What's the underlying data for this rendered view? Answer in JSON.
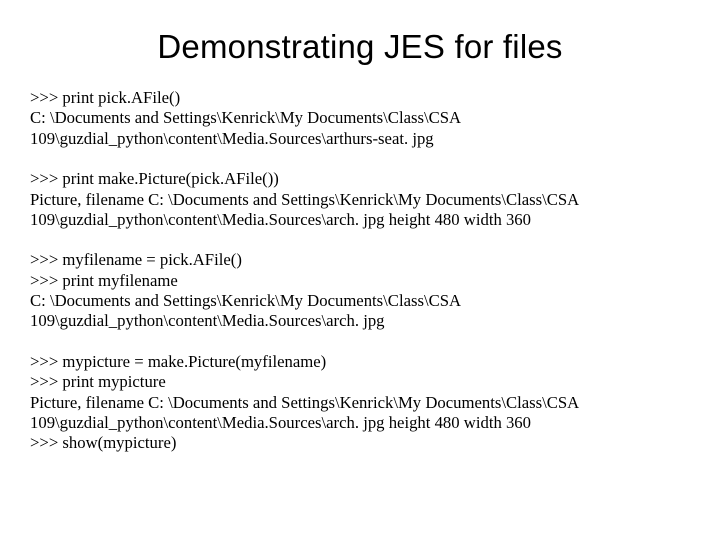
{
  "title": "Demonstrating JES for files",
  "blocks": [
    {
      "lines": [
        ">>> print pick.AFile()",
        "C: \\Documents and Settings\\Kenrick\\My Documents\\Class\\CSA 109\\guzdial_python\\content\\Media.Sources\\arthurs-seat. jpg"
      ]
    },
    {
      "lines": [
        ">>> print make.Picture(pick.AFile())",
        "Picture, filename C: \\Documents and Settings\\Kenrick\\My Documents\\Class\\CSA 109\\guzdial_python\\content\\Media.Sources\\arch. jpg height 480 width 360"
      ]
    },
    {
      "lines": [
        ">>> myfilename = pick.AFile()",
        ">>> print myfilename",
        "C: \\Documents and Settings\\Kenrick\\My Documents\\Class\\CSA 109\\guzdial_python\\content\\Media.Sources\\arch. jpg"
      ]
    },
    {
      "lines": [
        ">>> mypicture = make.Picture(myfilename)",
        ">>> print mypicture",
        "Picture, filename C: \\Documents and Settings\\Kenrick\\My Documents\\Class\\CSA 109\\guzdial_python\\content\\Media.Sources\\arch. jpg height 480 width 360",
        ">>> show(mypicture)"
      ]
    }
  ]
}
